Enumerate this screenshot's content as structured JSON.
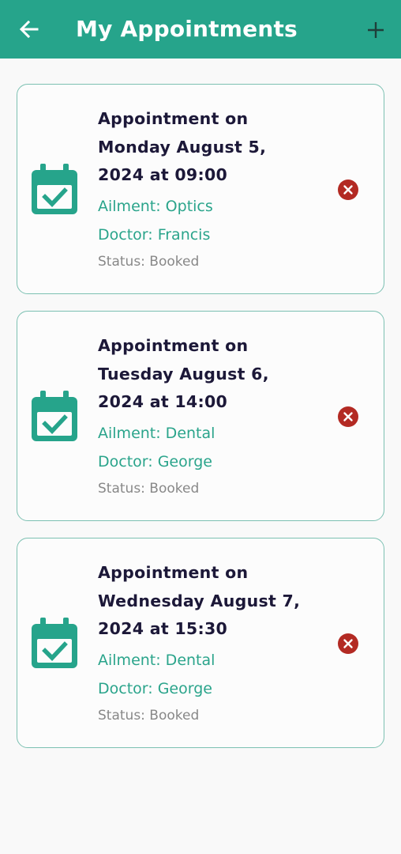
{
  "header": {
    "title": "My Appointments",
    "back_icon": "arrow-left-icon",
    "add_icon": "plus-icon",
    "background_color": "#26a48b"
  },
  "appointments": [
    {
      "heading_line1": "Appointment on",
      "heading_line2": "Monday August 5,",
      "heading_line3": "2024 at 09:00",
      "ailment": "Ailment: Optics",
      "doctor": "Doctor: Francis",
      "status": "Status: Booked"
    },
    {
      "heading_line1": "Appointment on",
      "heading_line2": "Tuesday August 6,",
      "heading_line3": "2024 at 14:00",
      "ailment": "Ailment: Dental",
      "doctor": "Doctor: George",
      "status": "Status: Booked"
    },
    {
      "heading_line1": "Appointment on",
      "heading_line2": "Wednesday August 7,",
      "heading_line3": "2024 at 15:30",
      "ailment": "Ailment: Dental",
      "doctor": "Doctor: George",
      "status": "Status: Booked"
    }
  ],
  "icons": {
    "calendar": "calendar-check-icon",
    "cancel": "cancel-circle-icon"
  },
  "colors": {
    "accent": "#26a48b",
    "heading_text": "#1c1838",
    "status_text": "#888888",
    "cancel_red": "#b32a23",
    "card_border": "#7cc0b2"
  }
}
